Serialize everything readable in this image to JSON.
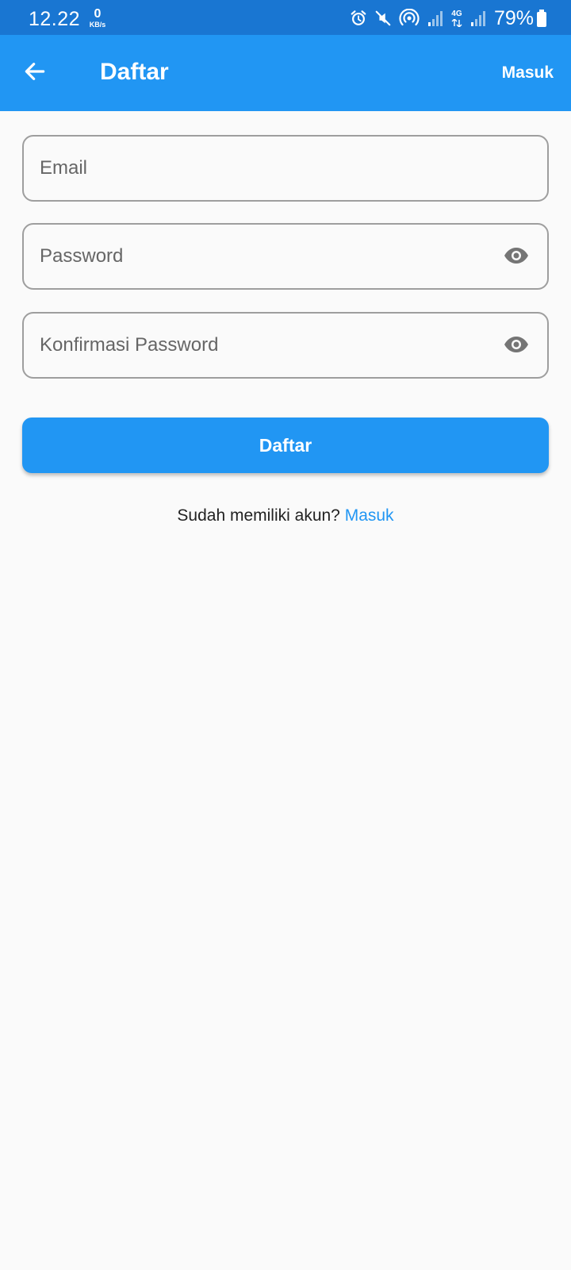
{
  "status_bar": {
    "time": "12.22",
    "net_speed_value": "0",
    "net_speed_unit": "KB/s",
    "network_type": "4G",
    "battery": "79%",
    "icons": [
      "alarm-icon",
      "mute-icon",
      "hotspot-icon",
      "signal-icon",
      "network-4g-icon",
      "signal-icon",
      "battery-icon"
    ]
  },
  "app_bar": {
    "title": "Daftar",
    "action_label": "Masuk",
    "back_icon": "arrow-back-icon",
    "color": "#2196f3"
  },
  "form": {
    "email_placeholder": "Email",
    "email_value": "",
    "password_placeholder": "Password",
    "password_value": "",
    "confirm_password_placeholder": "Konfirmasi Password",
    "confirm_password_value": "",
    "visibility_icon": "eye-icon",
    "submit_label": "Daftar"
  },
  "footer": {
    "prompt": "Sudah memiliki akun?",
    "link_label": "Masuk"
  },
  "colors": {
    "primary": "#2196f3",
    "status_bar": "#1976d2",
    "background": "#fafafa",
    "border": "#9e9e9e"
  }
}
